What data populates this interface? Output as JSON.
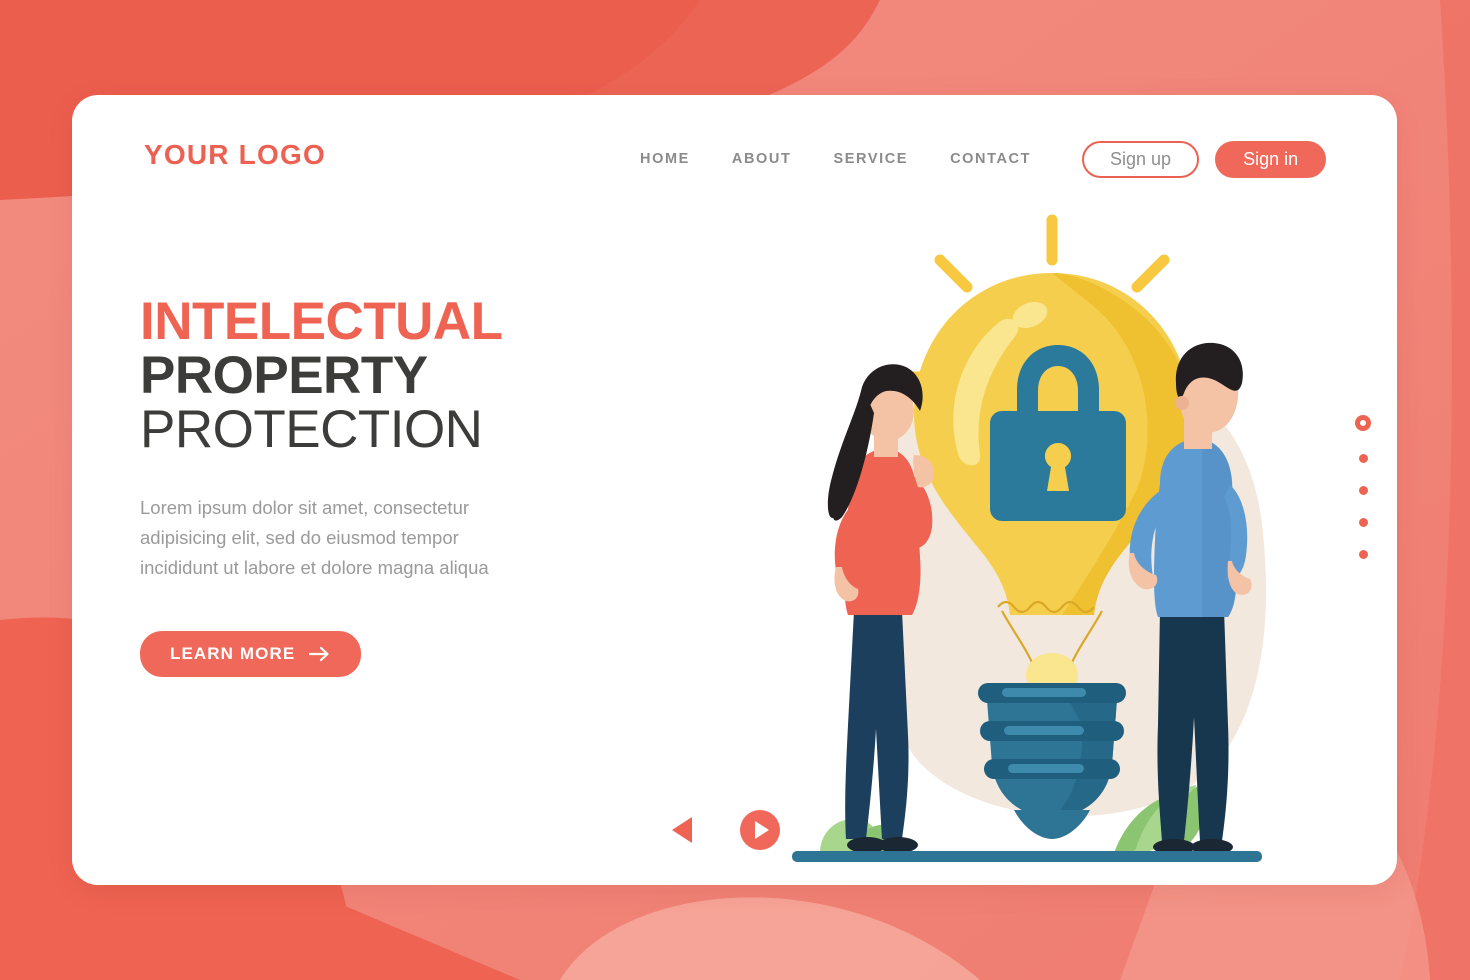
{
  "page": {
    "background_color": "#F08579",
    "card_color": "#FFFFFF",
    "accent_color": "#EE6352",
    "accent_fill_color": "#F0685A",
    "text_dark_color": "#3C3C3B",
    "text_muted_color": "#9A9A9A"
  },
  "header": {
    "logo": "YOUR LOGO",
    "nav": [
      {
        "label": "HOME"
      },
      {
        "label": "ABOUT"
      },
      {
        "label": "SERVICE"
      },
      {
        "label": "CONTACT"
      }
    ],
    "sign_up_label": "Sign up",
    "sign_in_label": "Sign in"
  },
  "hero": {
    "headline_line1": "INTELECTUAL",
    "headline_line2": "PROPERTY",
    "headline_line3": "PROTECTION",
    "description": "Lorem ipsum dolor sit amet, consectetur adipisicing elit, sed do eiusmod tempor incididunt ut labore et dolore magna aliqua",
    "cta_label": "LEARN MORE",
    "cta_icon": "arrow-right-icon"
  },
  "illustration": {
    "name": "lightbulb-with-padlock-illustration",
    "bulb_color": "#F5CE4D",
    "bulb_shadow_color": "#EFC02F",
    "bulb_base_color": "#2E7495",
    "padlock_color": "#2B7A9B",
    "rays_color": "#F8C940",
    "blob_color": "#F2E8DE",
    "ground_color": "#2E7495",
    "leaf_color": "#8CC572",
    "woman": {
      "name": "woman-character",
      "hair_color": "#231F20",
      "top_color": "#EE6352",
      "pants_color": "#1D3F5E",
      "skin_color": "#F4C3A6"
    },
    "man": {
      "name": "man-character",
      "hair_color": "#231F20",
      "shirt_color": "#5E9BD1",
      "pants_color": "#17374F",
      "skin_color": "#F4C3A6"
    }
  },
  "pagination": {
    "total": 5,
    "active_index": 0,
    "dot_color": "#EE6352"
  },
  "carousel": {
    "prev_icon": "triangle-left-icon",
    "next_icon": "play-circle-icon"
  }
}
